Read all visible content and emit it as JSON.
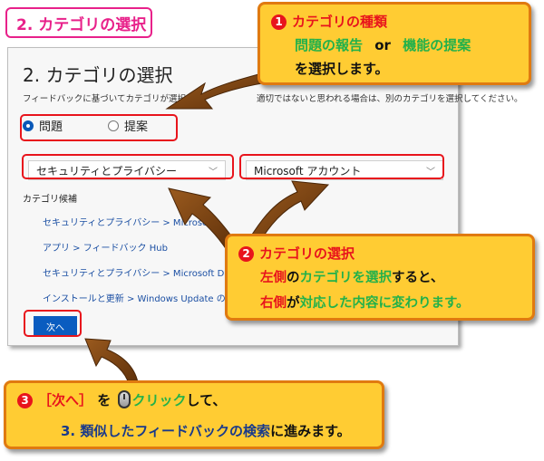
{
  "badge": {
    "title": "2. カテゴリの選択"
  },
  "screen": {
    "title": "2. カテゴリの選択",
    "description": "フィードバックに基づいてカテゴリが選択",
    "description_tail": "適切ではないと思われる場合は、別のカテゴリを選択してください。",
    "radio_problem": "問題",
    "radio_suggestion": "提案",
    "dropdown_left": "セキュリティとプライバシー",
    "dropdown_right": "Microsoft アカウント",
    "candidates_label": "カテゴリ候補",
    "candidates": [
      "セキュリティとプライバシー > Microsoft",
      "アプリ > フィードバック Hub",
      "セキュリティとプライバシー > Microsoft Defender アプ",
      "インストールと更新 > Windows Update のダウンロー"
    ],
    "next_button": "次へ"
  },
  "callout1": {
    "number": "❶",
    "heading": "カテゴリの種類",
    "opt1": "問題の報告",
    "or": "or",
    "opt2": "機能の提案",
    "line3": "を選択します。"
  },
  "callout2": {
    "number": "❷",
    "heading": "カテゴリの選択",
    "l2a": "左側",
    "l2b": "の",
    "l2c": "カテゴリを選択",
    "l2d": "すると、",
    "l3a": "右側",
    "l3b": "が",
    "l3c": "対応した内容に変わります。"
  },
  "callout3": {
    "number": "❸",
    "l1a": "［次へ］",
    "l1b": "を",
    "l1c": "クリック",
    "l1d": "して、",
    "l2": "3. 類似したフィードバックの検索",
    "l2b": "に進みます。"
  },
  "colors": {
    "accent_red": "#e8141c",
    "callout_fill": "#ffcc33",
    "callout_border": "#e07a10",
    "green": "#23b14a",
    "badge_pink": "#e8218a",
    "arrow_brown": "#7a4212",
    "button_blue": "#0a5cc0"
  }
}
